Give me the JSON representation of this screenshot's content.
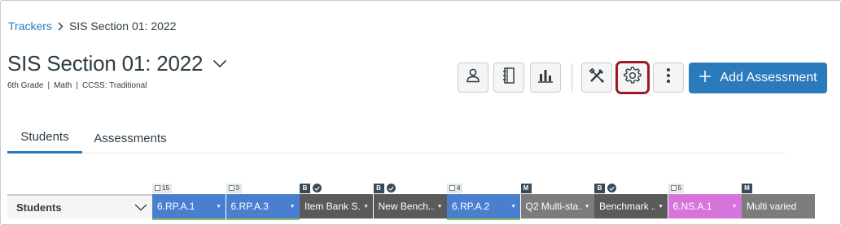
{
  "breadcrumb": {
    "parent": "Trackers",
    "current": "SIS Section 01: 2022"
  },
  "header": {
    "title": "SIS Section 01: 2022",
    "subtitle": {
      "grade": "6th Grade",
      "subject": "Math",
      "standards": "CCSS: Traditional"
    }
  },
  "toolbar": {
    "buttons": [
      {
        "name": "student-view-button",
        "icon": "person-icon"
      },
      {
        "name": "notebook-button",
        "icon": "notebook-icon"
      },
      {
        "name": "reports-button",
        "icon": "bar-chart-icon"
      },
      {
        "name": "tools-button",
        "icon": "tools-icon"
      },
      {
        "name": "settings-button",
        "icon": "gear-icon"
      },
      {
        "name": "more-options-button",
        "icon": "kebab-icon"
      }
    ],
    "add_label": "Add Assessment"
  },
  "tabs": [
    {
      "label": "Students",
      "active": true
    },
    {
      "label": "Assessments",
      "active": false
    }
  ],
  "grid": {
    "students_header": "Students",
    "columns": [
      {
        "tag_type": "count",
        "count": "15",
        "label": "6.RP.A.1",
        "color": "#4a7fd0",
        "underline": true
      },
      {
        "tag_type": "count",
        "count": "3",
        "label": "6.RP.A.3",
        "color": "#4a7fd0",
        "underline": true
      },
      {
        "tag_type": "letter",
        "letter": "B",
        "label": "Item Bank S...",
        "color": "#5a5a5a",
        "underline": false
      },
      {
        "tag_type": "letter",
        "letter": "B",
        "label": "New Bench...",
        "color": "#5a5a5a",
        "underline": false
      },
      {
        "tag_type": "count",
        "count": "4",
        "label": "6.RP.A.2",
        "color": "#4a7fd0",
        "underline": true
      },
      {
        "tag_type": "letter-only",
        "letter": "M",
        "label": "Q2 Multi-sta...",
        "color": "#7c7c7c",
        "underline": false
      },
      {
        "tag_type": "letter",
        "letter": "B",
        "label": "Benchmark ...",
        "color": "#5a5a5a",
        "underline": false
      },
      {
        "tag_type": "count",
        "count": "5",
        "label": "6.NS.A.1",
        "color": "#d774db",
        "underline": false
      },
      {
        "tag_type": "letter-only",
        "letter": "M",
        "label": "Multi varied",
        "color": "#7c7c7c",
        "underline": false
      }
    ]
  },
  "colors": {
    "accent": "#2b7abc",
    "highlight": "#9b1c24",
    "text": "#2d3b45"
  }
}
